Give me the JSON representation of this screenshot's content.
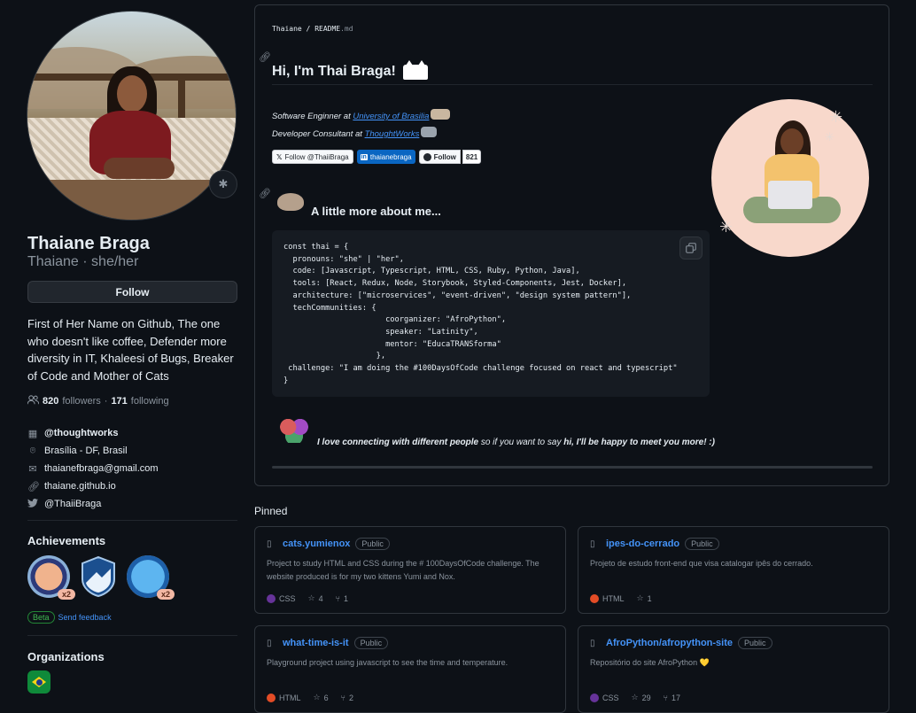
{
  "profile": {
    "name": "Thaiane Braga",
    "login_line": "Thaiane · she/her",
    "follow_label": "Follow",
    "bio": "First of Her Name on Github, The one who doesn't like coffee, Defender more diversity in IT, Khaleesi of Bugs, Breaker of Code and Mother of Cats",
    "followers_count": "820",
    "followers_label": "followers",
    "separator": "·",
    "following_count": "171",
    "following_label": "following",
    "details": {
      "company": "@thoughtworks",
      "location": "Brasília - DF, Brasil",
      "email": "thaianefbraga@gmail.com",
      "website": "thaiane.github.io",
      "twitter": "@ThaiiBraga"
    }
  },
  "achievements": {
    "heading": "Achievements",
    "badges": [
      {
        "icon": "cat-mask-badge",
        "count": "x2"
      },
      {
        "icon": "arctic-badge",
        "count": ""
      },
      {
        "icon": "shark-badge",
        "count": "x2"
      }
    ],
    "beta_label": "Beta",
    "feedback_label": "Send feedback"
  },
  "organizations": {
    "heading": "Organizations",
    "items": [
      {
        "icon": "brazil-flag-org"
      }
    ]
  },
  "readme": {
    "crumb_user": "Thaiane",
    "crumb_sep": "/",
    "crumb_file": "README",
    "crumb_ext": ".md",
    "title": "Hi, I'm Thai Braga!",
    "role1_prefix": "Software Enginner at ",
    "role1_link": "University of Brasilia",
    "role2_prefix": "Developer Consultant at ",
    "role2_link": "ThoughtWorks",
    "social": {
      "twitter": "Follow @ThaiiBraga",
      "linkedin": "thaianebraga",
      "github_follow": "Follow",
      "github_count": "821"
    },
    "more_heading": "A little more about me...",
    "code_lines": [
      "const thai = {",
      "  pronouns: \"she\" | \"her\",",
      "  code: [Javascript, Typescript, HTML, CSS, Ruby, Python, Java],",
      "  tools: [React, Redux, Node, Storybook, Styled-Components, Jest, Docker],",
      "  architecture: [\"microservices\", \"event-driven\", \"design system pattern\"],",
      "  techCommunities: {",
      "                      coorganizer: \"AfroPython\",",
      "                      speaker: \"Latinity\",",
      "                      mentor: \"EducaTRANSforma\"",
      "                    },",
      " challenge: \"I am doing the #100DaysOfCode challenge focused on react and typescript\"",
      "}"
    ],
    "quote_bold1": "I love connecting with different people",
    "quote_mid": " so if you want to say ",
    "quote_bold2": "hi, I'll be happy to meet you more! :)"
  },
  "pinned": {
    "heading": "Pinned",
    "repos": [
      {
        "owner": "",
        "name": "cats.yumienox",
        "visibility": "Public",
        "description": "Project to study HTML and CSS during the # 100DaysOfCode challenge. The website produced is for my two kittens Yumi and Nox.",
        "language": "CSS",
        "language_color": "#663399",
        "stars": "4",
        "forks": "1"
      },
      {
        "owner": "",
        "name": "ipes-do-cerrado",
        "visibility": "Public",
        "description": "Projeto de estudo front-end que visa catalogar ipês do cerrado.",
        "language": "HTML",
        "language_color": "#e34c26",
        "stars": "1",
        "forks": ""
      },
      {
        "owner": "",
        "name": "what-time-is-it",
        "visibility": "Public",
        "description": "Playground project using javascript to see the time and temperature.",
        "language": "HTML",
        "language_color": "#e34c26",
        "stars": "6",
        "forks": "2"
      },
      {
        "owner": "AfroPython/",
        "name": "afropython-site",
        "visibility": "Public",
        "description": "Repositório do site AfroPython 💛",
        "language": "CSS",
        "language_color": "#663399",
        "stars": "29",
        "forks": "17"
      }
    ]
  },
  "colors": {
    "background": "#0d1117",
    "link": "#4493f8",
    "muted": "#8b949e",
    "border": "#30363d"
  }
}
